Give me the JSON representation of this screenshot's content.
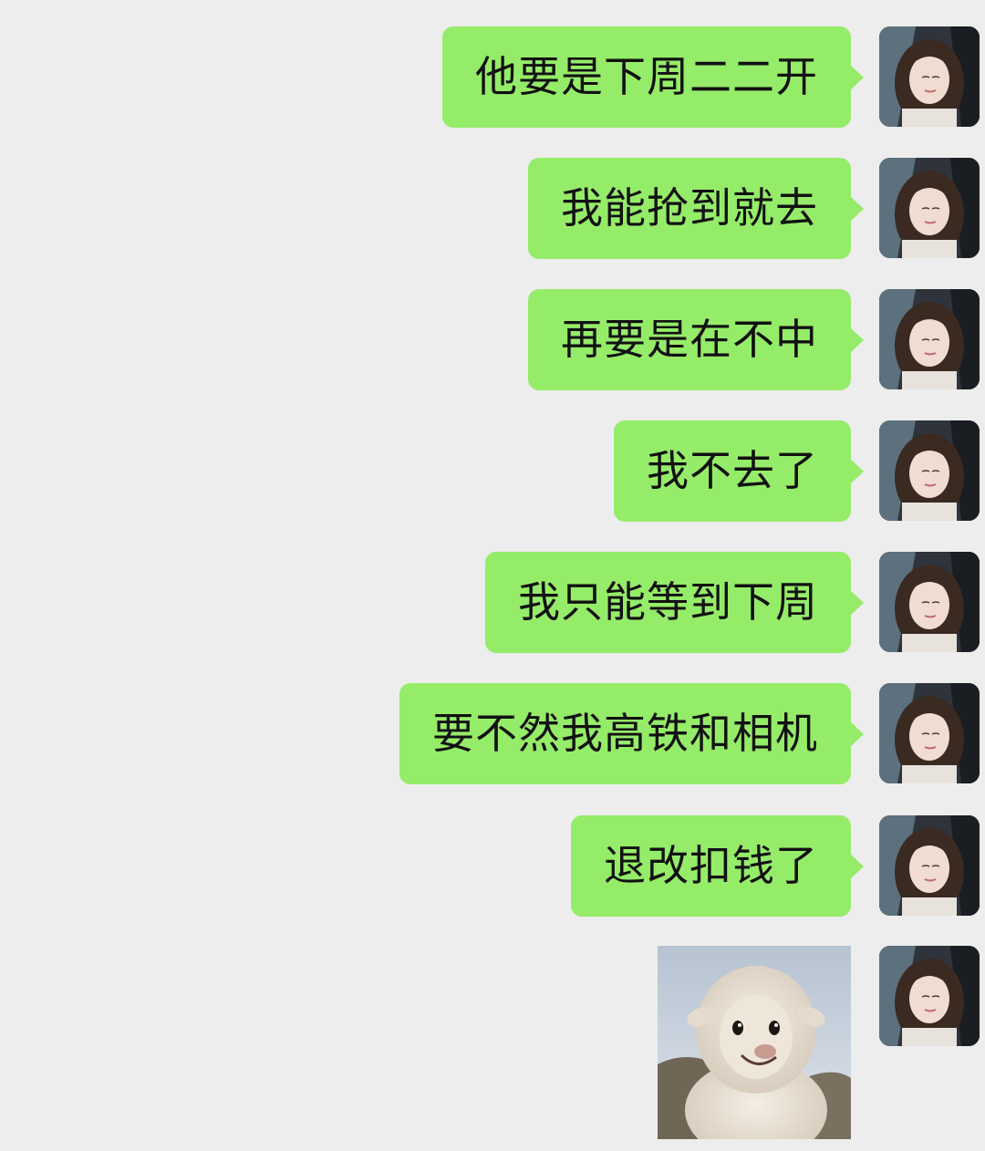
{
  "conversation": {
    "messages": [
      {
        "sender": "me",
        "text": "他要是下周二二开"
      },
      {
        "sender": "me",
        "text": "我能抢到就去"
      },
      {
        "sender": "me",
        "text": "再要是在不中"
      },
      {
        "sender": "me",
        "text": "我不去了"
      },
      {
        "sender": "me",
        "text": "我只能等到下周"
      },
      {
        "sender": "me",
        "text": "要不然我高铁和相机"
      },
      {
        "sender": "me",
        "text": "退改扣钱了"
      },
      {
        "sender": "me",
        "type": "sticker",
        "icon": "smiling-sheep-sticker"
      }
    ]
  },
  "theme": {
    "background": "#ededed",
    "bubble_color": "#95ec69",
    "text_color": "#111111"
  }
}
